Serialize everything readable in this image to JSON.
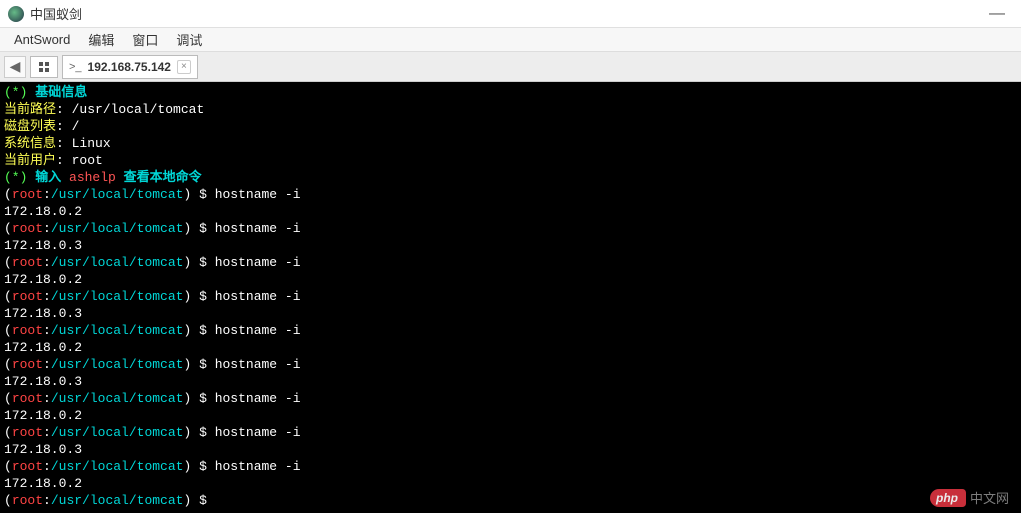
{
  "window": {
    "title": "中国蚁剑",
    "minimize": "—"
  },
  "menu": {
    "items": [
      "AntSword",
      "编辑",
      "窗口",
      "调试"
    ]
  },
  "tabs": {
    "nav_prev": "◀",
    "active": {
      "prefix": ">_",
      "label": "192.168.75.142",
      "close": "×"
    }
  },
  "terminal": {
    "header_info": {
      "prefix": "(*)",
      "title": "基础信息",
      "path_label": "当前路径",
      "path_value": "/usr/local/tomcat",
      "disk_label": "磁盘列表",
      "disk_value": "/",
      "sys_label": "系统信息",
      "sys_value": "Linux",
      "user_label": "当前用户",
      "user_value": "root"
    },
    "hint": {
      "prefix": "(*)",
      "pre": "输入",
      "cmd": "ashelp",
      "post": "查看本地命令"
    },
    "prompt": {
      "user": "root",
      "sep": ":",
      "path": "/usr/local/tomcat",
      "sigil": "$"
    },
    "command": "hostname -i",
    "outputs": [
      "172.18.0.2",
      "172.18.0.3",
      "172.18.0.2",
      "172.18.0.3",
      "172.18.0.2",
      "172.18.0.3",
      "172.18.0.2",
      "172.18.0.3",
      "172.18.0.2"
    ]
  },
  "watermark": {
    "pill": "php",
    "text": "中文网"
  }
}
